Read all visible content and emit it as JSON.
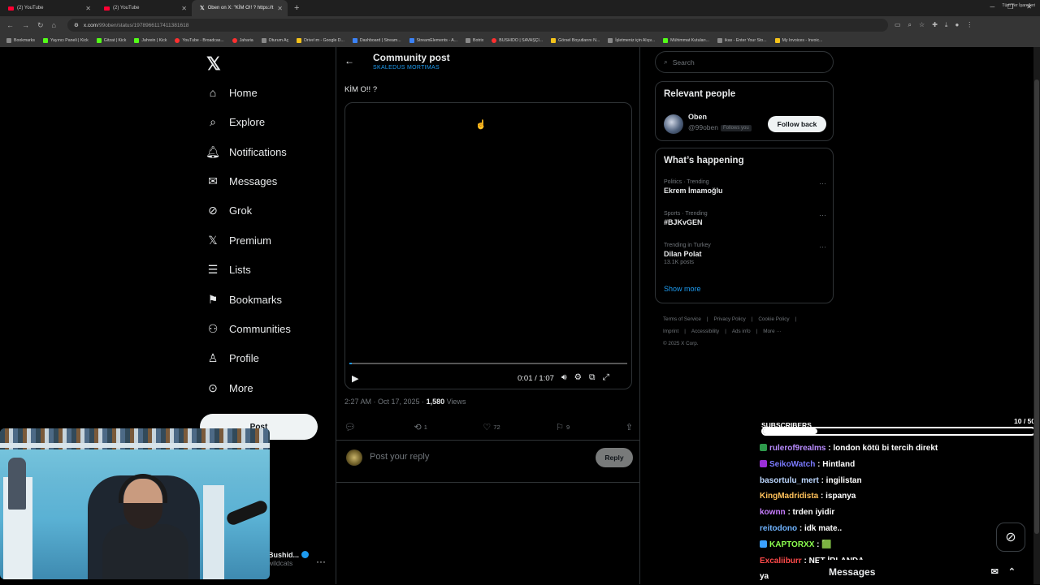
{
  "browser": {
    "tabs": [
      {
        "label": "(2) YouTube"
      },
      {
        "label": "(2) YouTube"
      },
      {
        "label": "Oben on X: \"KİM O!! ? https://t"
      }
    ],
    "url_host": "x.com",
    "url_path": "/99oben/status/1978966117411381618",
    "bookmarks": [
      {
        "label": "Bookmarks",
        "color": "g"
      },
      {
        "label": "Yayıncı Paneli | Kick",
        "color": "k"
      },
      {
        "label": "Gitzat | Kick",
        "color": "k"
      },
      {
        "label": "Jahrein | Kick",
        "color": "k"
      },
      {
        "label": "YouTube - Broadcas...",
        "color": "r"
      },
      {
        "label": "Jaharia",
        "color": "r"
      },
      {
        "label": "Oturum Aç",
        "color": "g"
      },
      {
        "label": "Drive'ım - Google D...",
        "color": "y"
      },
      {
        "label": "Dashboard | Stream...",
        "color": "b"
      },
      {
        "label": "StreamElements - A...",
        "color": "b"
      },
      {
        "label": "Botrix",
        "color": "g"
      },
      {
        "label": "BUSHIDO | SAVAŞÇI...",
        "color": "r"
      },
      {
        "label": "Görsel Boyutlarını N...",
        "color": "y"
      },
      {
        "label": "İşletmeniz için Alışv...",
        "color": "g"
      },
      {
        "label": "Mühimmat Kutuları...",
        "color": "k"
      },
      {
        "label": "ikas - Enter Your Sto...",
        "color": "g"
      },
      {
        "label": "My Invoices - Invoic...",
        "color": "y"
      }
    ],
    "bookmarks_right": "Tüm Yer İşaretleri"
  },
  "sidebar": {
    "items": [
      {
        "label": "Home",
        "icon": "home-icon",
        "glyph": "⌂"
      },
      {
        "label": "Explore",
        "icon": "search-icon",
        "glyph": "⌕"
      },
      {
        "label": "Notifications",
        "icon": "bell-icon",
        "glyph": "🔔︎"
      },
      {
        "label": "Messages",
        "icon": "mail-icon",
        "glyph": "✉"
      },
      {
        "label": "Grok",
        "icon": "grok-icon",
        "glyph": "⊘"
      },
      {
        "label": "Premium",
        "icon": "x-premium-icon",
        "glyph": "𝕏"
      },
      {
        "label": "Lists",
        "icon": "list-icon",
        "glyph": "☰"
      },
      {
        "label": "Bookmarks",
        "icon": "bookmark-icon",
        "glyph": "⚑"
      },
      {
        "label": "Communities",
        "icon": "communities-icon",
        "glyph": "⚇"
      },
      {
        "label": "Profile",
        "icon": "person-icon",
        "glyph": "♙"
      },
      {
        "label": "More",
        "icon": "more-circle-icon",
        "glyph": "⊙"
      }
    ],
    "post_button": "Post",
    "account_name": "Bushid...",
    "account_handle": "wildcats"
  },
  "post": {
    "header_title": "Community post",
    "community": "SKALEDUS MORTIMAS",
    "text": "KİM O!! ?",
    "video_time": "0:01 / 1:07",
    "video_progress": 0.01,
    "timestamp": "2:27 AM · Oct 17, 2025 · ",
    "views_count": "1,580",
    "views_label": " Views",
    "replies": "",
    "reposts": "1",
    "likes": "72",
    "bookmarks": "9",
    "reply_placeholder": "Post your reply",
    "reply_button": "Reply"
  },
  "right": {
    "search_placeholder": "Search",
    "relevant_title": "Relevant people",
    "person_name": "Oben",
    "person_handle": "@99oben",
    "follows_you": "Follows you",
    "follow_button": "Follow back",
    "happening_title": "What’s happening",
    "trends": [
      {
        "meta": "Politics · Trending",
        "name": "Ekrem İmamoğlu",
        "sub": ""
      },
      {
        "meta": "Sports · Trending",
        "name": "#BJKvGEN",
        "sub": ""
      },
      {
        "meta": "Trending in Turkey",
        "name": "Dilan Polat",
        "sub": "13.1K posts"
      }
    ],
    "show_more": "Show more",
    "footer_links": [
      "Terms of Service",
      "|",
      "Privacy Policy",
      "|",
      "Cookie Policy",
      "|",
      "Imprint",
      "|",
      "Accessibility",
      "|",
      "Ads info",
      "|",
      "More ···"
    ],
    "copyright": "© 2025 X Corp."
  },
  "overlay": {
    "subs_label": "SUBSCRIBERS",
    "subs_count": "10 / 50",
    "subs_progress": 0.2,
    "chat": [
      {
        "user": "rulerof9realms",
        "msg": " : london kötü bi tercih direkt",
        "color": "#b98cff",
        "badge": "#2e9a4c"
      },
      {
        "user": "SeikoWatch",
        "msg": " : Hintland",
        "color": "#7a7aff",
        "badge": "#9b2fd8"
      },
      {
        "user": "basortulu_mert",
        "msg": " : ingilistan",
        "color": "#bcd7ff",
        "badge": ""
      },
      {
        "user": "KingMadridista",
        "msg": " : ispanya",
        "color": "#ffc15a",
        "badge": ""
      },
      {
        "user": "kownn",
        "msg": " : trden iyidir",
        "color": "#c77dff",
        "badge": ""
      },
      {
        "user": "reitodono",
        "msg": " : idk mate..",
        "color": "#6fb3ff",
        "badge": ""
      },
      {
        "user": "KAPTORXX",
        "msg": " : 🟩",
        "color": "#8cff4f",
        "badge": "#3aa0ff"
      },
      {
        "user": "Excaliiburr",
        "msg": " : NET İRLANDA",
        "color": "#ff4a4a",
        "badge": ""
      },
      {
        "user": "",
        "msg": "ya",
        "color": "#fff",
        "badge": ""
      }
    ],
    "messages_label": "Messages"
  }
}
